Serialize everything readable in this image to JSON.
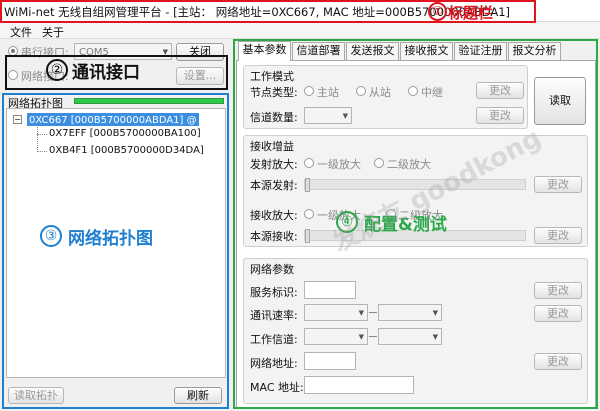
{
  "window": {
    "title": "WiMi-net 无线自组网管理平台 - [主站： 网络地址=0XC667, MAC 地址=000B5700000ABDA1]"
  },
  "menu": [
    "文件",
    "关于"
  ],
  "serial": {
    "radio_serial": "串行接口:",
    "port": "COM5",
    "close_button": "关闭",
    "radio_network": "网络接口:",
    "settings_button": "设置..."
  },
  "topology": {
    "header": "网络拓扑图",
    "root": "0XC667 [000B5700000ABDA1] @",
    "children": [
      "0X7EFF [000B5700000BA100]",
      "0XB4F1 [000B5700000D34DA]"
    ],
    "read_button": "读取拓扑",
    "refresh_button": "刷新"
  },
  "tabs": [
    "基本参数",
    "信道部署",
    "发送报文",
    "接收报文",
    "验证注册",
    "报文分析"
  ],
  "work_mode": {
    "title": "工作模式",
    "node_type_label": "节点类型:",
    "options": [
      "主站",
      "从站",
      "中继"
    ],
    "change_button": "更改",
    "channel_count_label": "信道数量:",
    "read_button": "读取"
  },
  "gain": {
    "title": "接收增益",
    "tx_amp_label": "发射放大:",
    "level1": "一级放大",
    "level2": "二级放大",
    "local_tx_label": "本源发射:",
    "change_button": "更改",
    "rx_amp_label": "接收放大:",
    "local_rx_label": "本源接收:"
  },
  "network": {
    "title": "网络参数",
    "service_id_label": "服务标识:",
    "baud_label": "通讯速率:",
    "work_channel_label": "工作信道:",
    "net_addr_label": "网络地址:",
    "mac_label": "MAC 地址:",
    "change_button": "更改"
  },
  "annotations": {
    "a1": "①",
    "a1_label": "标题栏",
    "a2": "②",
    "a2_label": "通讯接口",
    "a3": "③",
    "a3_label": "网络拓扑图",
    "a4": "④",
    "a4_label": "配置&测试"
  },
  "colors": {
    "red": "#e0141e",
    "black": "#111111",
    "blue": "#1f7fd1",
    "green": "#2aa84a",
    "selection": "#3c8fe0"
  },
  "watermark": "发烧友  goodkong"
}
